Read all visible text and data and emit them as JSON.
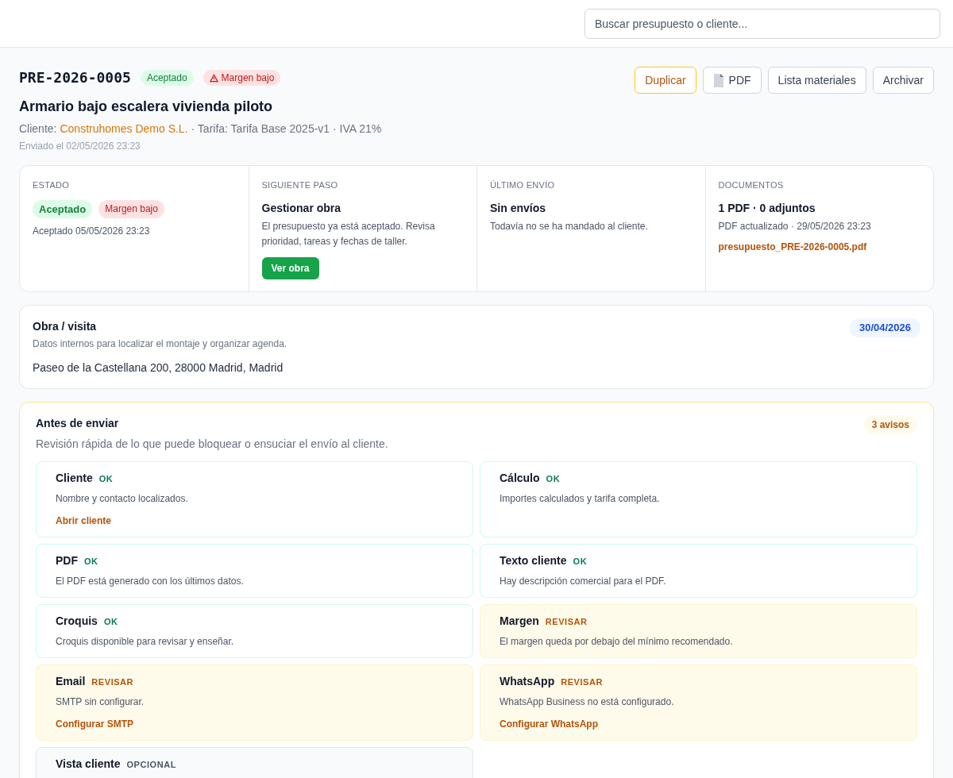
{
  "search": {
    "placeholder": "Buscar presupuesto o cliente..."
  },
  "header": {
    "code": "PRE-2026-0005",
    "badges": [
      {
        "label": "Aceptado",
        "kind": "success",
        "warning": false
      },
      {
        "label": "Margen bajo",
        "kind": "danger",
        "warning": true
      }
    ],
    "title": "Armario bajo escalera vivienda piloto",
    "client_label": "Cliente:",
    "client": "Construhomes Demo S.L.",
    "meta": "· Tarifa: Tarifa Base 2025-v1 · IVA 21%",
    "sent": "Enviado el 02/05/2026 23:23"
  },
  "actions": [
    {
      "label": "Duplicar",
      "kind": "primary"
    },
    {
      "label": "PDF",
      "kind": "pdf"
    },
    {
      "label": "Lista materiales",
      "kind": "plain"
    },
    {
      "label": "Archivar",
      "kind": "plain"
    }
  ],
  "summary": [
    {
      "heading": "ESTADO",
      "kind": "status",
      "badges": [
        {
          "label": "Aceptado",
          "kind": "success"
        },
        {
          "label": "Margen bajo",
          "kind": "danger"
        }
      ],
      "note": "Aceptado 05/05/2026 23:23"
    },
    {
      "heading": "SIGUIENTE PASO",
      "kind": "step",
      "title": "Gestionar obra",
      "text": "El presupuesto ya está aceptado. Revisa prioridad, tareas y fechas de taller.",
      "button": "Ver obra"
    },
    {
      "heading": "ÚLTIMO ENVÍO",
      "kind": "text",
      "title": "Sin envíos",
      "text": "Todavía no se ha mandado al cliente."
    },
    {
      "heading": "DOCUMENTOS",
      "kind": "docs",
      "title": "1 PDF · 0 adjuntos",
      "text": "PDF actualizado · 29/05/2026 23:23",
      "link": "presupuesto_PRE-2026-0005.pdf"
    }
  ],
  "site": {
    "title": "Obra / visita",
    "subtitle": "Datos internos para localizar el montaje y organizar agenda.",
    "date": "30/04/2026",
    "address": "Paseo de la Castellana 200, 28000 Madrid, Madrid"
  },
  "checks": {
    "title": "Antes de enviar",
    "subtitle": "Revisión rápida de lo que puede bloquear o ensuciar el envío al cliente.",
    "count": "3 avisos",
    "items": [
      {
        "title": "Cliente",
        "status": "OK",
        "kind": "ok",
        "text": "Nombre y contacto localizados.",
        "link": "Abrir cliente"
      },
      {
        "title": "Cálculo",
        "status": "OK",
        "kind": "ok",
        "text": "Importes calculados y tarifa completa."
      },
      {
        "title": "PDF",
        "status": "OK",
        "kind": "ok",
        "text": "El PDF está generado con los últimos datos."
      },
      {
        "title": "Texto cliente",
        "status": "OK",
        "kind": "ok",
        "text": "Hay descripción comercial para el PDF."
      },
      {
        "title": "Croquis",
        "status": "OK",
        "kind": "ok",
        "text": "Croquis disponible para revisar y enseñar."
      },
      {
        "title": "Margen",
        "status": "REVISAR",
        "kind": "review",
        "text": "El margen queda por debajo del mínimo recomendado."
      },
      {
        "title": "Email",
        "status": "REVISAR",
        "kind": "review",
        "text": "SMTP sin configurar.",
        "link": "Configurar SMTP"
      },
      {
        "title": "WhatsApp",
        "status": "REVISAR",
        "kind": "review",
        "text": "WhatsApp Business no está configurado.",
        "link": "Configurar WhatsApp"
      },
      {
        "title": "Vista cliente",
        "status": "OPCIONAL",
        "kind": "optional"
      }
    ]
  }
}
